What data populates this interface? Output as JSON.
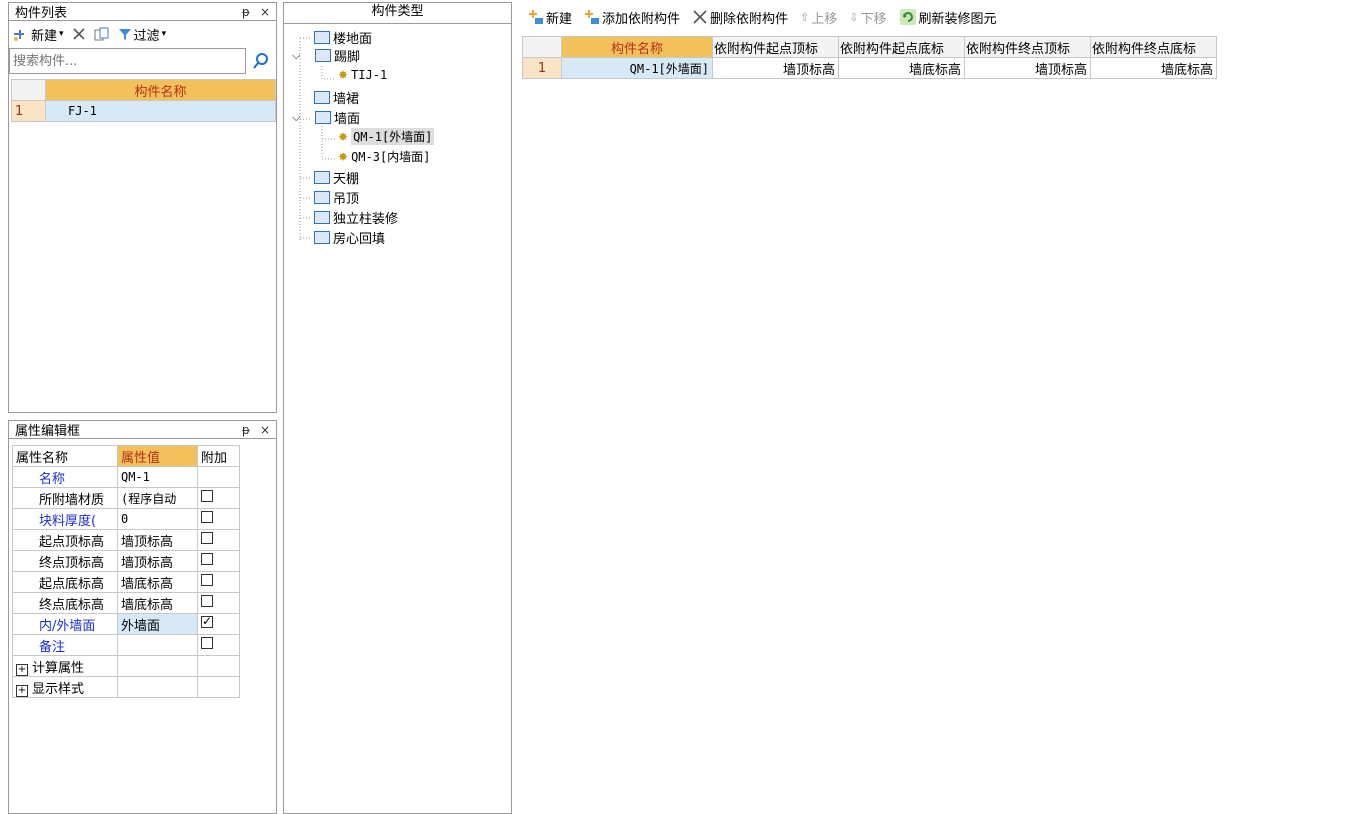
{
  "left_panel": {
    "title": "构件列表",
    "pin": "ᵽ",
    "close": "×",
    "toolbar": {
      "new_label": "新建",
      "filter_label": "过滤"
    },
    "search_placeholder": "搜索构件...",
    "header": "构件名称",
    "rows": [
      {
        "num": "1",
        "name": "FJ-1"
      }
    ]
  },
  "props_panel": {
    "title": "属性编辑框",
    "pin": "ᵽ",
    "close": "×",
    "headers": {
      "name": "属性名称",
      "value": "属性值",
      "extra": "附加"
    },
    "rows": [
      {
        "name": "名称",
        "value": "QM-1",
        "blue": true,
        "checkbox": "none"
      },
      {
        "name": "所附墙材质",
        "value": "(程序自动",
        "blue": false,
        "checkbox": "off"
      },
      {
        "name": "块料厚度(",
        "value": "0",
        "blue": true,
        "checkbox": "off"
      },
      {
        "name": "起点顶标高",
        "value": "墙顶标高",
        "blue": false,
        "checkbox": "off"
      },
      {
        "name": "终点顶标高",
        "value": "墙顶标高",
        "blue": false,
        "checkbox": "off"
      },
      {
        "name": "起点底标高",
        "value": "墙底标高",
        "blue": false,
        "checkbox": "off"
      },
      {
        "name": "终点底标高",
        "value": "墙底标高",
        "blue": false,
        "checkbox": "off"
      },
      {
        "name": "内/外墙面",
        "value": "外墙面",
        "blue": true,
        "checkbox": "on"
      },
      {
        "name": "备注",
        "value": "",
        "blue": true,
        "checkbox": "off"
      },
      {
        "name": "计算属性",
        "value": "",
        "blue": false,
        "checkbox": "none",
        "expand": "+"
      },
      {
        "name": "显示样式",
        "value": "",
        "blue": false,
        "checkbox": "none",
        "expand": "+"
      }
    ]
  },
  "tree_panel": {
    "title": "构件类型",
    "nodes": [
      {
        "label": "楼地面",
        "icon": "floor-icon"
      },
      {
        "label": "踢脚",
        "icon": "baseboard-icon",
        "expanded": true
      },
      {
        "label": "TIJ-1",
        "icon": "gear-icon",
        "child": true
      },
      {
        "label": "墙裙",
        "icon": "wainscot-icon"
      },
      {
        "label": "墙面",
        "icon": "wall-surface-icon",
        "expanded": true
      },
      {
        "label": "QM-1[外墙面]",
        "icon": "gear-icon",
        "child": true,
        "selected": true
      },
      {
        "label": "QM-3[内墙面]",
        "icon": "gear-icon",
        "child": true
      },
      {
        "label": "天棚",
        "icon": "ceiling-icon"
      },
      {
        "label": "吊顶",
        "icon": "suspended-ceiling-icon"
      },
      {
        "label": "独立柱装修",
        "icon": "column-icon"
      },
      {
        "label": "房心回填",
        "icon": "backfill-icon"
      }
    ]
  },
  "main": {
    "toolbar": {
      "new_label": "新建",
      "add_label": "添加依附构件",
      "delete_label": "删除依附构件",
      "up_label": "上移",
      "down_label": "下移",
      "refresh_label": "刷新装修图元"
    },
    "headers": [
      "构件名称",
      "依附构件起点顶标",
      "依附构件起点底标",
      "依附构件终点顶标",
      "依附构件终点底标"
    ],
    "rows": [
      {
        "num": "1",
        "cells": [
          "QM-1[外墙面]",
          "墙顶标高",
          "墙底标高",
          "墙顶标高",
          "墙底标高"
        ]
      }
    ]
  },
  "colors": {
    "accent": "#f2c15a",
    "selection": "#d7e8f6",
    "rownum": "#fbe4c6",
    "blue_text": "#1a2fd6"
  }
}
